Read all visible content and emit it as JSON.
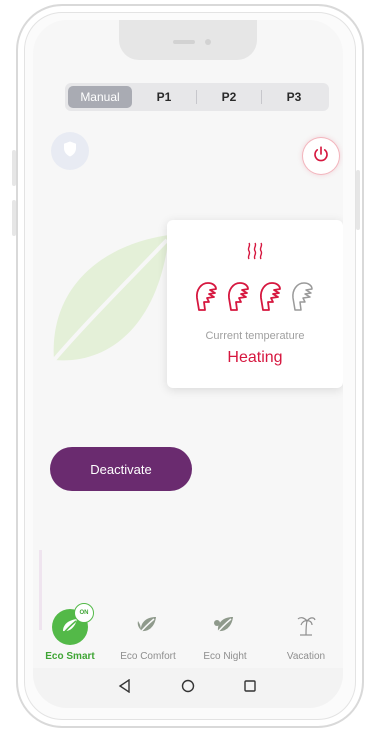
{
  "segmented": {
    "options": [
      {
        "label": "Manual",
        "active": true
      },
      {
        "label": "P1",
        "active": false
      },
      {
        "label": "P2",
        "active": false
      },
      {
        "label": "P3",
        "active": false
      }
    ]
  },
  "icons": {
    "shield": "shield-icon",
    "power": "power-icon",
    "heating": "heat-waves-icon",
    "hand": "hand-icon",
    "leaf": "leaf-icon",
    "palm": "palm-tree-icon"
  },
  "temperature_card": {
    "label": "Current temperature",
    "status": "Heating",
    "level_filled": 3,
    "level_total": 4
  },
  "deactivate_label": "Deactivate",
  "nav": {
    "items": [
      {
        "label": "Eco Smart",
        "active": true,
        "badge": "ON"
      },
      {
        "label": "Eco Comfort",
        "active": false
      },
      {
        "label": "Eco Night",
        "active": false
      },
      {
        "label": "Vacation",
        "active": false
      }
    ]
  },
  "colors": {
    "accent_red": "#d6173f",
    "purple": "#6a2b6f",
    "green": "#53b948",
    "segment_active": "#a9abb3"
  }
}
